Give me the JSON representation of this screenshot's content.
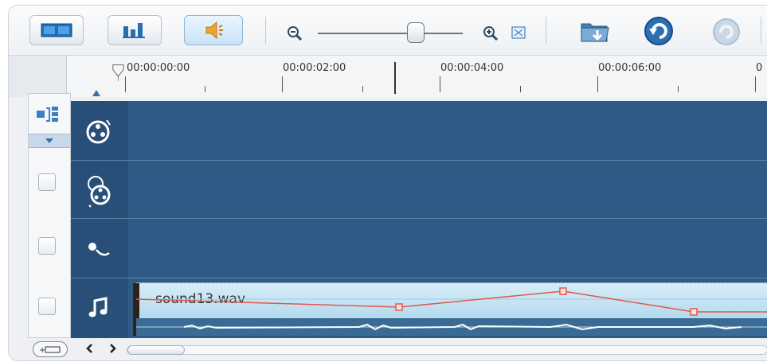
{
  "toolbar": {
    "buttons": [
      {
        "name": "storyboard-view",
        "icon": "filmstrip-icon"
      },
      {
        "name": "timeline-view",
        "icon": "timeline-icon"
      },
      {
        "name": "audio-view",
        "icon": "speaker-icon"
      }
    ],
    "zoom": {
      "out_icon": "zoom-out-icon",
      "in_icon": "zoom-in-icon",
      "fit_icon": "fit-window-icon"
    },
    "actions": [
      {
        "name": "insert-media",
        "icon": "folder-down-icon"
      },
      {
        "name": "undo",
        "icon": "undo-icon"
      },
      {
        "name": "redo",
        "icon": "redo-icon"
      }
    ]
  },
  "ruler": {
    "labels": [
      "00:00:00:00",
      "00:00:02:00",
      "00:00:04:00",
      "00:00:06:00",
      "0"
    ]
  },
  "tracks": [
    {
      "name": "video-track",
      "icon": "film-reel-icon"
    },
    {
      "name": "overlay-track",
      "icon": "film-reel-overlay-icon"
    },
    {
      "name": "voice-track",
      "icon": "microphone-icon"
    },
    {
      "name": "music-track",
      "icon": "music-note-icon"
    }
  ],
  "clip": {
    "label": "sound13.wav"
  },
  "colors": {
    "track_bg": "#2f5a86",
    "clip_bg": "#bddff1",
    "volume_line": "#e0584b"
  }
}
